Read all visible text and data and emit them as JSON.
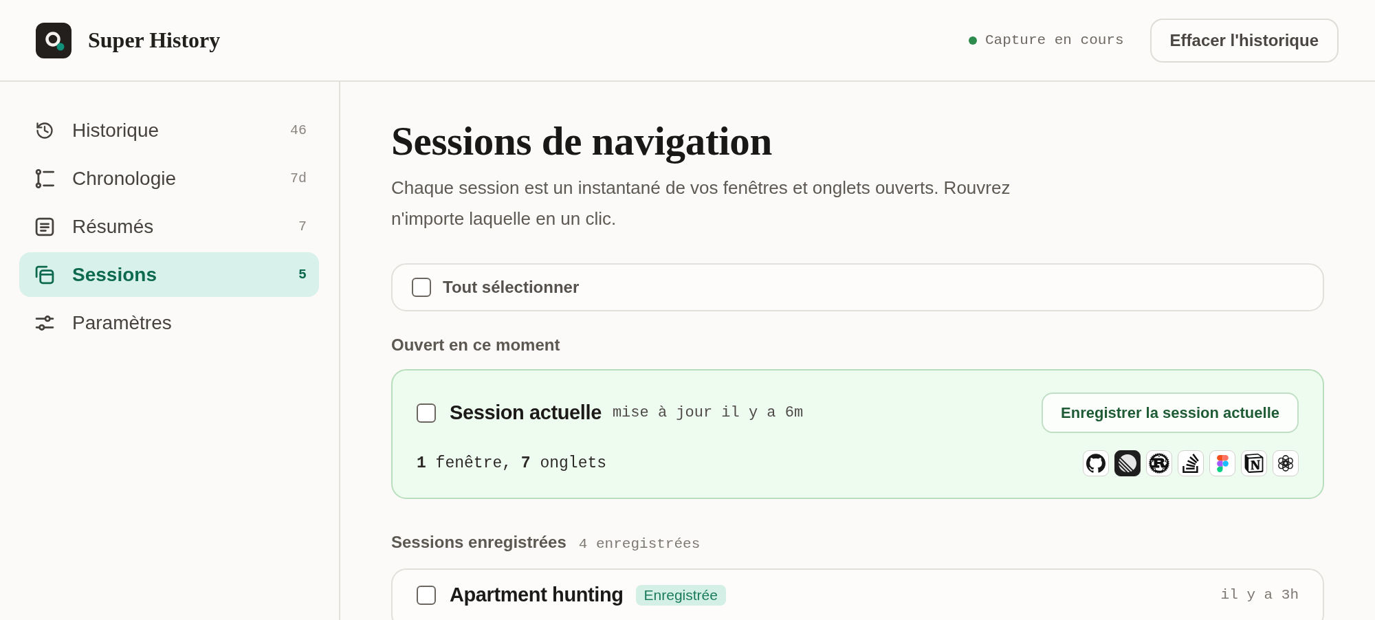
{
  "header": {
    "app_name": "Super History",
    "status": {
      "label": "Capture en cours",
      "active": true
    },
    "clear_button": "Effacer l'historique"
  },
  "sidebar": {
    "items": [
      {
        "kind": "history",
        "label": "Historique",
        "count": "46",
        "selected": false
      },
      {
        "kind": "timeline",
        "label": "Chronologie",
        "count": "7d",
        "selected": false
      },
      {
        "kind": "summaries",
        "label": "Résumés",
        "count": "7",
        "selected": false
      },
      {
        "kind": "sessions",
        "label": "Sessions",
        "count": "5",
        "selected": true
      },
      {
        "kind": "settings",
        "label": "Paramètres",
        "selected": false
      }
    ]
  },
  "main": {
    "title": "Sessions de navigation",
    "description": "Chaque session est un instantané de vos fenêtres et onglets ouverts. Rouvrez n'importe laquelle en un clic.",
    "select_all": {
      "label": "Tout sélectionner",
      "checked": false
    },
    "current_section": {
      "heading": "Ouvert en ce moment",
      "session": {
        "name": "Session actuelle",
        "updated": "mise à jour il y a 6m",
        "checked": false,
        "save_button": "Enregistrer la session actuelle",
        "summary": "**1** fenêtre, **7** onglets",
        "tab_icons": [
          {
            "kind": "github"
          },
          {
            "kind": "linear"
          },
          {
            "kind": "rust"
          },
          {
            "kind": "stackoverflow"
          },
          {
            "kind": "figma"
          },
          {
            "kind": "notion"
          },
          {
            "kind": "openai"
          }
        ]
      }
    },
    "saved_section": {
      "heading": "Sessions enregistrées",
      "count": "4 enregistrées",
      "sessions": [
        {
          "name": "Apartment hunting",
          "badge": "Enregistrée",
          "time": "il y a 3h",
          "checked": false
        }
      ]
    }
  }
}
